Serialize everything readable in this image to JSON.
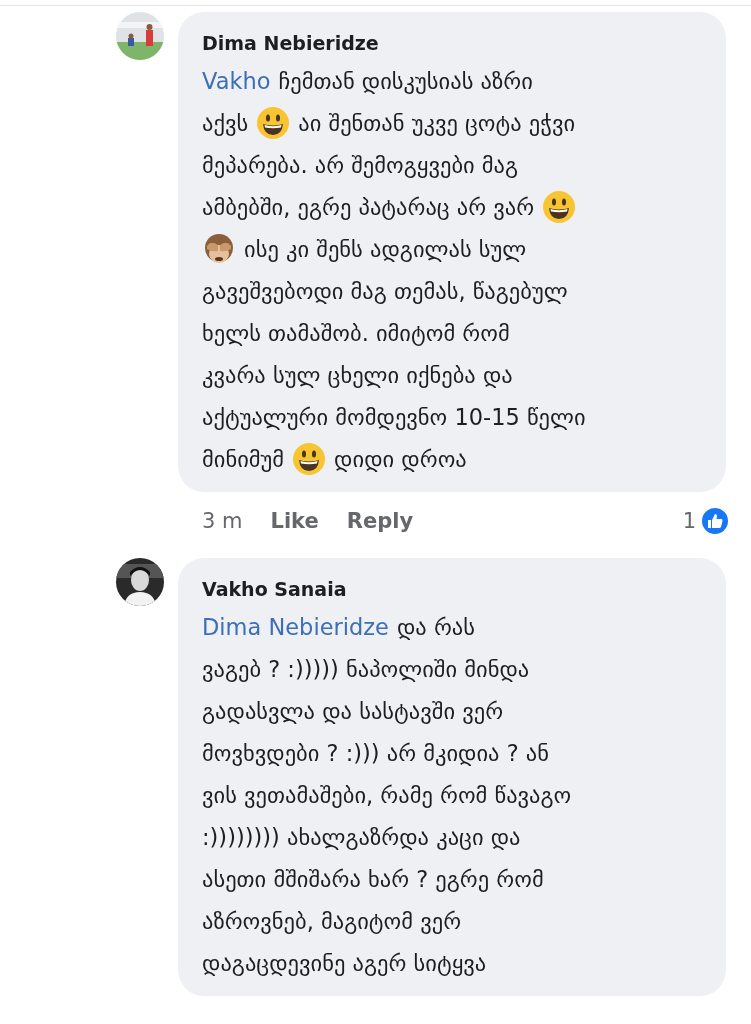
{
  "comments": [
    {
      "author": "Dima Nebieridze",
      "lines": [
        [
          {
            "kind": "mention",
            "text": "Vakho"
          },
          {
            "kind": "text",
            "text": "ჩემთან დისკუსიას აზრი"
          }
        ],
        [
          {
            "kind": "text",
            "text": "აქვს"
          },
          {
            "kind": "grin"
          },
          {
            "kind": "text",
            "text": "აი შენთან უკვე ცოტა ეჭვი"
          }
        ],
        [
          {
            "kind": "text",
            "text": "მეპარება. არ შემოგყვები მაგ"
          }
        ],
        [
          {
            "kind": "text",
            "text": "ამბებში, ეგრე პატარაც არ ვარ"
          },
          {
            "kind": "grin"
          }
        ],
        [
          {
            "kind": "monkey"
          },
          {
            "kind": "text",
            "text": "ისე კი შენს ადგილას სულ"
          }
        ],
        [
          {
            "kind": "text",
            "text": "გავეშვებოდი მაგ თემას, წაგებულ"
          }
        ],
        [
          {
            "kind": "text",
            "text": "ხელს თამაშობ. იმიტომ რომ"
          }
        ],
        [
          {
            "kind": "text",
            "text": "კვარა სულ ცხელი იქნება და"
          }
        ],
        [
          {
            "kind": "text",
            "text": "აქტუალური მომდევნო 10-15 წელი"
          }
        ],
        [
          {
            "kind": "text",
            "text": "მინიმუმ"
          },
          {
            "kind": "grin"
          },
          {
            "kind": "text",
            "text": "დიდი დროა"
          }
        ]
      ],
      "footer": {
        "time": "3 m",
        "actions": [
          "Like",
          "Reply"
        ],
        "reaction_count": "1"
      }
    },
    {
      "author": "Vakho Sanaia",
      "lines": [
        [
          {
            "kind": "mention",
            "text": "Dima Nebieridze"
          },
          {
            "kind": "text",
            "text": "და რას"
          }
        ],
        [
          {
            "kind": "text",
            "text": "ვაგებ ? :))))) ნაპოლიში მინდა"
          }
        ],
        [
          {
            "kind": "text",
            "text": "გადასვლა და სასტავში ვერ"
          }
        ],
        [
          {
            "kind": "text",
            "text": "მოვხვდები ? :))) არ მკიდია ? ან"
          }
        ],
        [
          {
            "kind": "text",
            "text": "ვის ვეთამაშები, რამე რომ წავაგო"
          }
        ],
        [
          {
            "kind": "text",
            "text": ":)))))))) ახალგაზრდა კაცი და"
          }
        ],
        [
          {
            "kind": "text",
            "text": "ასეთი მშიშარა ხარ ? ეგრე რომ"
          }
        ],
        [
          {
            "kind": "text",
            "text": "აზროვნებ, მაგიტომ ვერ"
          }
        ],
        [
          {
            "kind": "text",
            "text": "დაგაცდევინე აგერ სიტყვა"
          }
        ]
      ]
    }
  ]
}
